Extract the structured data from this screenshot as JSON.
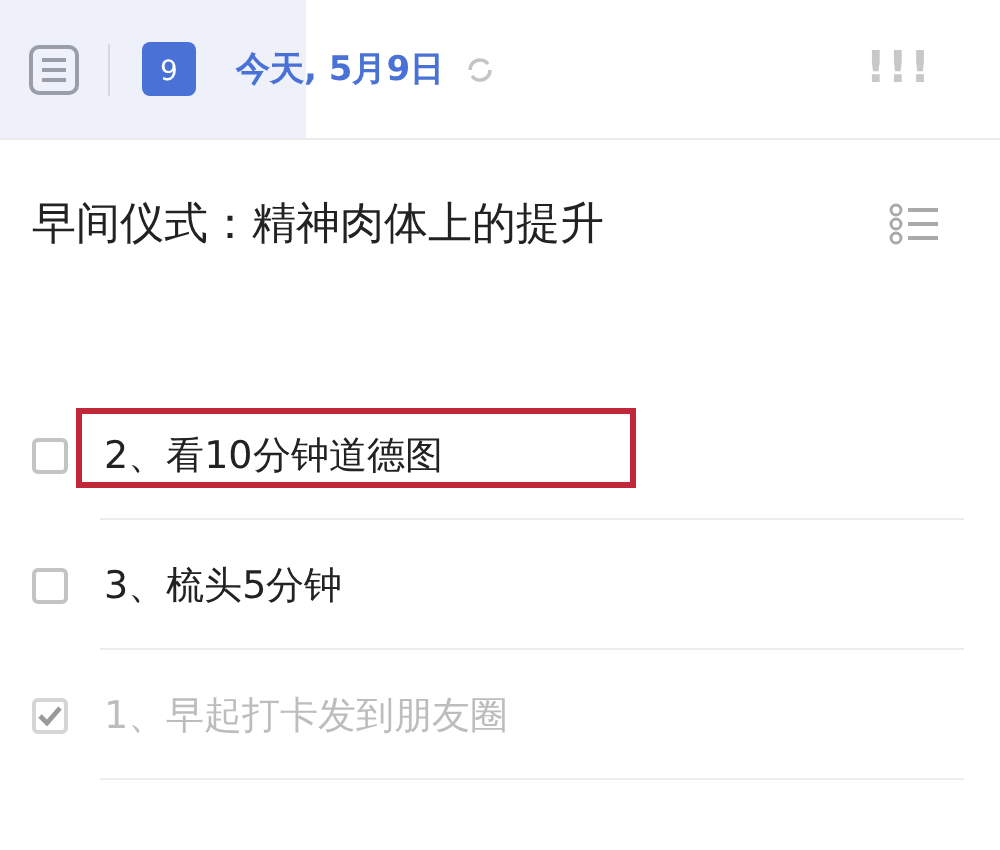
{
  "header": {
    "calendar_day": "9",
    "date": "今天, 5月9日",
    "priority": "!!!"
  },
  "title": "早间仪式：精神肉体上的提升",
  "tasks": [
    {
      "text": "2、看10分钟道德图",
      "checked": false,
      "highlighted": true
    },
    {
      "text": "3、梳头5分钟",
      "checked": false,
      "highlighted": false
    },
    {
      "text": "1、早起打卡发到朋友圈",
      "checked": true,
      "highlighted": false
    }
  ]
}
